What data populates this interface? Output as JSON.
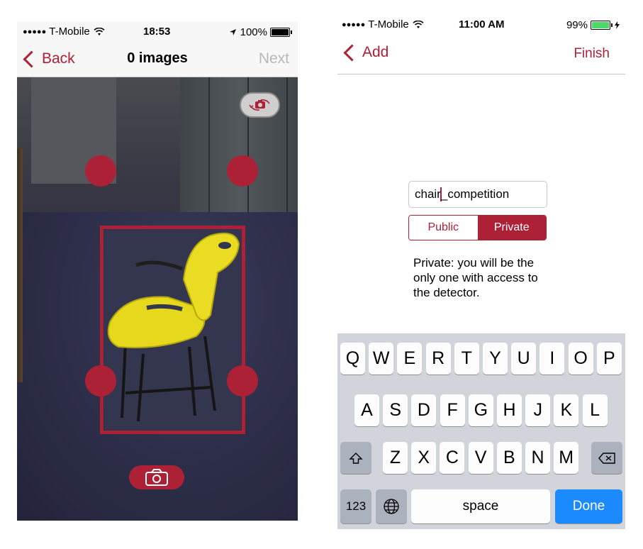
{
  "left_screen": {
    "status": {
      "signal_dots": "●●●●●",
      "carrier": "T-Mobile",
      "time": "18:53",
      "battery_percent": "100%",
      "battery_level": 1.0
    },
    "nav": {
      "back_label": "Back",
      "title": "0 images",
      "next_label": "Next",
      "next_enabled": false
    },
    "icons": {
      "flip_camera": "camera-flip-icon",
      "capture": "camera-icon",
      "location": "location-arrow-icon",
      "wifi": "wifi-icon"
    }
  },
  "right_screen": {
    "status": {
      "signal_dots": "●●●●●",
      "carrier": "T-Mobile",
      "time": "11:00 AM",
      "battery_percent": "99%",
      "battery_level": 0.99
    },
    "nav": {
      "back_label": "Add",
      "finish_label": "Finish"
    },
    "name_field": {
      "value_before_caret": "chair",
      "value_after_caret": "_competition"
    },
    "visibility": {
      "options": [
        "Public",
        "Private"
      ],
      "selected": "Private"
    },
    "help_text": "Private: you will be the only one with access to the detector.",
    "keyboard": {
      "row1": [
        "Q",
        "W",
        "E",
        "R",
        "T",
        "Y",
        "U",
        "I",
        "O",
        "P"
      ],
      "row2": [
        "A",
        "S",
        "D",
        "F",
        "G",
        "H",
        "J",
        "K",
        "L"
      ],
      "row3": [
        "Z",
        "X",
        "C",
        "V",
        "B",
        "N",
        "M"
      ],
      "numbers_key": "123",
      "space_key": "space",
      "done_key": "Done"
    }
  },
  "colors": {
    "accent": "#ad2137",
    "done_blue": "#1b8aff",
    "battery_green": "#4cd964",
    "disabled_gray": "#b8b8b8"
  }
}
